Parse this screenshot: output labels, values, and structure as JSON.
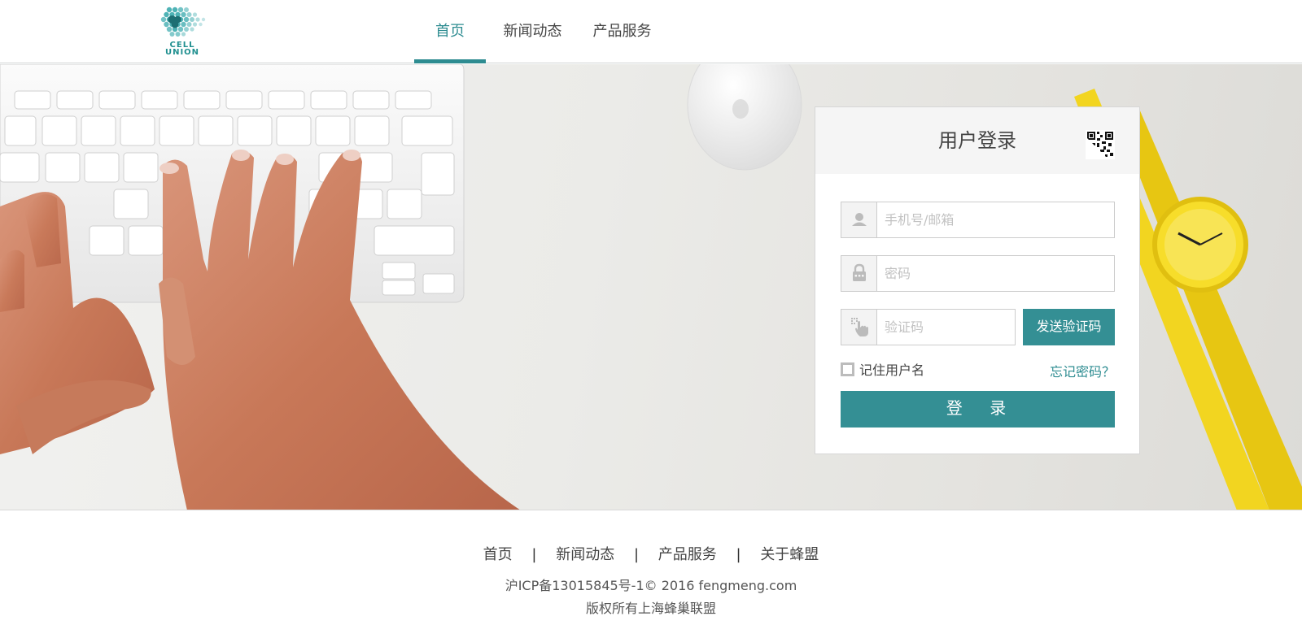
{
  "header": {
    "logo_text_line1": "CELL",
    "logo_text_line2": "UNION",
    "nav": [
      {
        "label": "首页",
        "active": true
      },
      {
        "label": "新闻动态",
        "active": false
      },
      {
        "label": "产品服务",
        "active": false
      }
    ]
  },
  "login": {
    "title": "用户登录",
    "username_placeholder": "手机号/邮箱",
    "password_placeholder": "密码",
    "code_placeholder": "验证码",
    "send_code_label": "发送验证码",
    "remember_label": "记住用户名",
    "remember_checked": false,
    "forgot_label": "忘记密码？",
    "submit_label": "登 录",
    "icons": [
      "user-icon",
      "lock-icon",
      "pointer-icon",
      "qrcode-icon"
    ]
  },
  "footer": {
    "links": [
      "首页",
      "新闻动态",
      "产品服务",
      "关于蜂盟"
    ],
    "separator": "|",
    "icp": "沪ICP备13015845号-1© 2016 fengmeng.com",
    "copyright": "版权所有上海蜂巢联盟"
  },
  "colors": {
    "accent": "#348f94",
    "nav_active": "#2e8c91",
    "text": "#444444"
  }
}
